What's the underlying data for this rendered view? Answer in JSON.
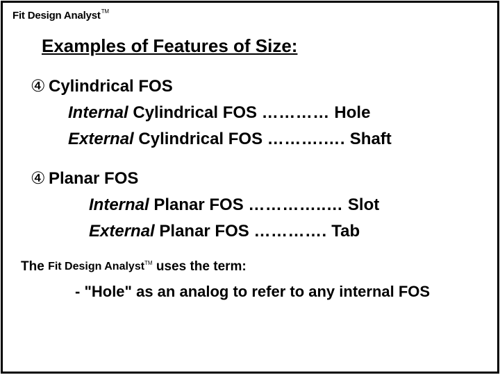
{
  "brand": {
    "name": "Fit Design Analyst",
    "tm": "TM"
  },
  "title": "Examples of Features of Size:",
  "bullet_glyph": "④",
  "sections": {
    "cyl": {
      "heading": "Cylindrical FOS",
      "internal_prefix": "Internal",
      "internal_text": " Cylindrical FOS ",
      "internal_dots": "…………",
      "internal_value": " Hole",
      "external_prefix": "External",
      "external_text": " Cylindrical FOS ",
      "external_dots": "……….….",
      "external_value": " Shaft"
    },
    "planar": {
      "heading": "Planar FOS",
      "internal_prefix": "Internal",
      "internal_text": " Planar FOS ",
      "internal_dots": "…………..…",
      "internal_value": " Slot",
      "external_prefix": "External",
      "external_text": " Planar FOS ",
      "external_dots": "………….",
      "external_value": " Tab"
    }
  },
  "termline": {
    "prefix": "The ",
    "suffix": " uses the term:"
  },
  "analog": "- \"Hole\" as an analog to refer to any internal FOS"
}
